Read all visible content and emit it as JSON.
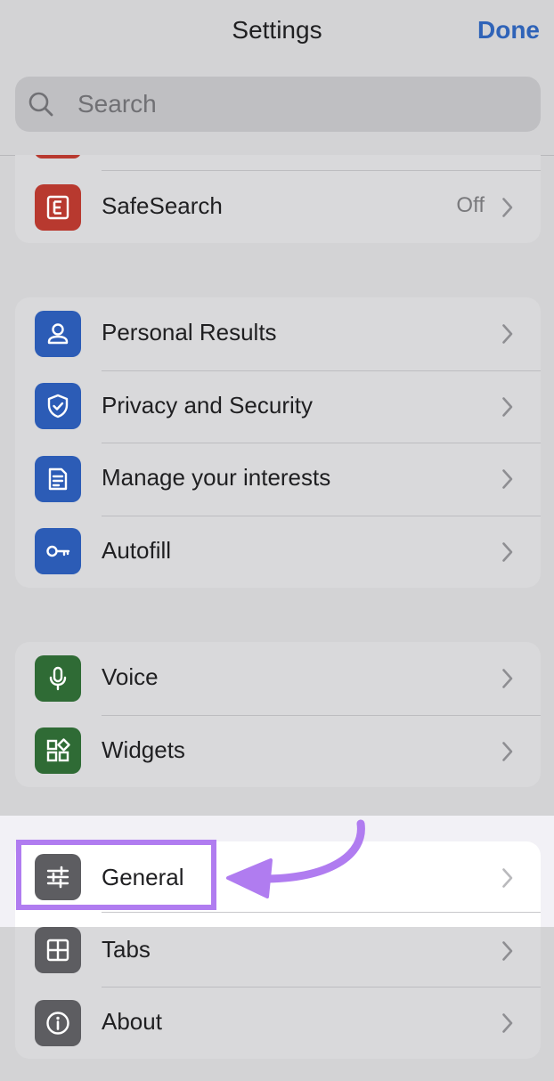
{
  "header": {
    "title": "Settings",
    "done_label": "Done"
  },
  "search": {
    "placeholder": "Search"
  },
  "colors": {
    "accent": "#2f63b8",
    "red_tile": "#b8392f",
    "blue_tile": "#2c5cb6",
    "green_tile": "#2f6b35",
    "gray_tile": "#5d5d61",
    "highlight": "#b07cf0"
  },
  "group_safesearch": {
    "items": [
      {
        "label": "SafeSearch",
        "value": "Off",
        "icon": "safesearch-e-icon"
      }
    ]
  },
  "group_personal": {
    "items": [
      {
        "label": "Personal Results",
        "icon": "person-icon"
      },
      {
        "label": "Privacy and Security",
        "icon": "shield-check-icon"
      },
      {
        "label": "Manage your interests",
        "icon": "document-icon"
      },
      {
        "label": "Autofill",
        "icon": "key-icon"
      }
    ]
  },
  "group_tools": {
    "items": [
      {
        "label": "Voice",
        "icon": "microphone-icon"
      },
      {
        "label": "Widgets",
        "icon": "widgets-icon"
      }
    ]
  },
  "group_general": {
    "items": [
      {
        "label": "General",
        "icon": "sliders-icon"
      },
      {
        "label": "Tabs",
        "icon": "tabs-grid-icon"
      },
      {
        "label": "About",
        "icon": "info-icon"
      }
    ]
  }
}
